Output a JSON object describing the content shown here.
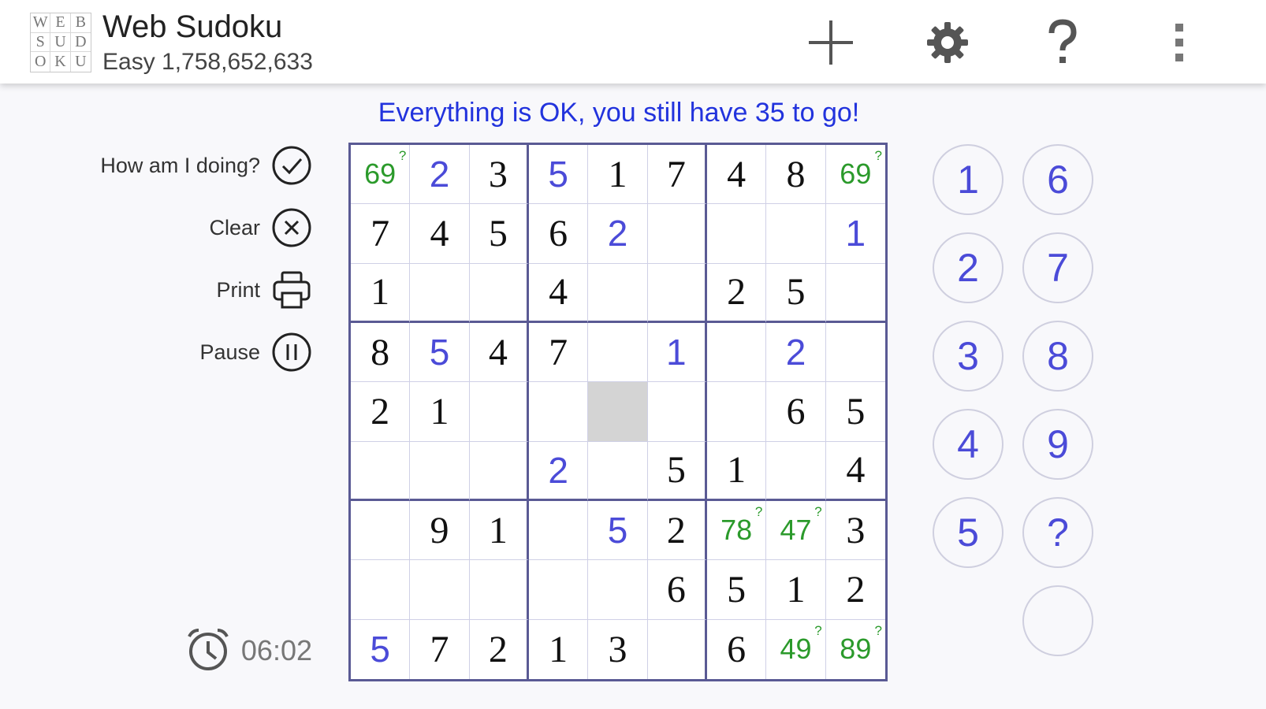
{
  "app": {
    "title": "Web Sudoku",
    "subtitle": "Easy 1,758,652,633",
    "logo_letters": [
      "W",
      "E",
      "B",
      "S",
      "U",
      "D",
      "O",
      "K",
      "U"
    ]
  },
  "toolbar": {
    "new_icon": "plus-icon",
    "settings_icon": "gear-icon",
    "help_icon": "question-icon",
    "menu_icon": "more-vert-icon"
  },
  "status_message": "Everything is OK, you still have 35 to go!",
  "actions": [
    {
      "label": "How am I doing?",
      "icon": "check-circle-icon"
    },
    {
      "label": "Clear",
      "icon": "close-circle-icon"
    },
    {
      "label": "Print",
      "icon": "printer-icon"
    },
    {
      "label": "Pause",
      "icon": "pause-circle-icon"
    }
  ],
  "timer": {
    "icon": "alarm-clock-icon",
    "value": "06:02"
  },
  "colors": {
    "user_digit": "#4b4bd8",
    "note_digit": "#2b9a2b",
    "status_text": "#2233dd",
    "grid_major": "#5a5a94",
    "selected_cell": "#d4d4d4"
  },
  "board": [
    [
      {
        "v": "69",
        "t": "note"
      },
      {
        "v": "2",
        "t": "user"
      },
      {
        "v": "3",
        "t": "given"
      },
      {
        "v": "5",
        "t": "user"
      },
      {
        "v": "1",
        "t": "given"
      },
      {
        "v": "7",
        "t": "given"
      },
      {
        "v": "4",
        "t": "given"
      },
      {
        "v": "8",
        "t": "given"
      },
      {
        "v": "69",
        "t": "note"
      }
    ],
    [
      {
        "v": "7",
        "t": "given"
      },
      {
        "v": "4",
        "t": "given"
      },
      {
        "v": "5",
        "t": "given"
      },
      {
        "v": "6",
        "t": "given"
      },
      {
        "v": "2",
        "t": "user"
      },
      {
        "v": "",
        "t": "empty"
      },
      {
        "v": "",
        "t": "empty"
      },
      {
        "v": "",
        "t": "empty"
      },
      {
        "v": "1",
        "t": "user"
      }
    ],
    [
      {
        "v": "1",
        "t": "given"
      },
      {
        "v": "",
        "t": "empty"
      },
      {
        "v": "",
        "t": "empty"
      },
      {
        "v": "4",
        "t": "given"
      },
      {
        "v": "",
        "t": "empty"
      },
      {
        "v": "",
        "t": "empty"
      },
      {
        "v": "2",
        "t": "given"
      },
      {
        "v": "5",
        "t": "given"
      },
      {
        "v": "",
        "t": "empty"
      }
    ],
    [
      {
        "v": "8",
        "t": "given"
      },
      {
        "v": "5",
        "t": "user"
      },
      {
        "v": "4",
        "t": "given"
      },
      {
        "v": "7",
        "t": "given"
      },
      {
        "v": "",
        "t": "empty"
      },
      {
        "v": "1",
        "t": "user"
      },
      {
        "v": "",
        "t": "empty"
      },
      {
        "v": "2",
        "t": "user"
      },
      {
        "v": "",
        "t": "empty"
      }
    ],
    [
      {
        "v": "2",
        "t": "given"
      },
      {
        "v": "1",
        "t": "given"
      },
      {
        "v": "",
        "t": "empty"
      },
      {
        "v": "",
        "t": "empty"
      },
      {
        "v": "",
        "t": "selected"
      },
      {
        "v": "",
        "t": "empty"
      },
      {
        "v": "",
        "t": "empty"
      },
      {
        "v": "6",
        "t": "given"
      },
      {
        "v": "5",
        "t": "given"
      }
    ],
    [
      {
        "v": "",
        "t": "empty"
      },
      {
        "v": "",
        "t": "empty"
      },
      {
        "v": "",
        "t": "empty"
      },
      {
        "v": "2",
        "t": "user"
      },
      {
        "v": "",
        "t": "empty"
      },
      {
        "v": "5",
        "t": "given"
      },
      {
        "v": "1",
        "t": "given"
      },
      {
        "v": "",
        "t": "empty"
      },
      {
        "v": "4",
        "t": "given"
      }
    ],
    [
      {
        "v": "",
        "t": "empty"
      },
      {
        "v": "9",
        "t": "given"
      },
      {
        "v": "1",
        "t": "given"
      },
      {
        "v": "",
        "t": "empty"
      },
      {
        "v": "5",
        "t": "user"
      },
      {
        "v": "2",
        "t": "given"
      },
      {
        "v": "78",
        "t": "note"
      },
      {
        "v": "47",
        "t": "note"
      },
      {
        "v": "3",
        "t": "given"
      }
    ],
    [
      {
        "v": "",
        "t": "empty"
      },
      {
        "v": "",
        "t": "empty"
      },
      {
        "v": "",
        "t": "empty"
      },
      {
        "v": "",
        "t": "empty"
      },
      {
        "v": "",
        "t": "empty"
      },
      {
        "v": "6",
        "t": "given"
      },
      {
        "v": "5",
        "t": "given"
      },
      {
        "v": "1",
        "t": "given"
      },
      {
        "v": "2",
        "t": "given"
      }
    ],
    [
      {
        "v": "5",
        "t": "user"
      },
      {
        "v": "7",
        "t": "given"
      },
      {
        "v": "2",
        "t": "given"
      },
      {
        "v": "1",
        "t": "given"
      },
      {
        "v": "3",
        "t": "given"
      },
      {
        "v": "",
        "t": "empty"
      },
      {
        "v": "6",
        "t": "given"
      },
      {
        "v": "49",
        "t": "note"
      },
      {
        "v": "89",
        "t": "note"
      }
    ]
  ],
  "note_marker": "?",
  "pad": {
    "left": [
      "1",
      "2",
      "3",
      "4",
      "5"
    ],
    "right": [
      "6",
      "7",
      "8",
      "9",
      "?",
      ""
    ]
  }
}
